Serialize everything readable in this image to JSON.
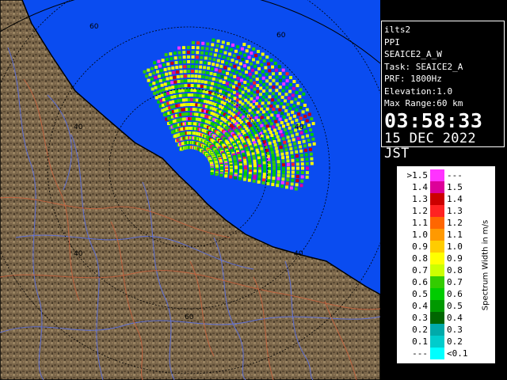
{
  "header": {
    "site": "ilts2",
    "product": "PPI",
    "scan_name": "SEAICE2_A_W",
    "task": "Task: SEAICE2_A",
    "prf": "PRF: 1800Hz",
    "elevation": "Elevation:1.0",
    "max_range": "Max Range:60 km",
    "time": "03:58:33",
    "date": "15 DEC 2022 JST"
  },
  "range_rings": {
    "labels": [
      "60",
      "60",
      "40",
      "40",
      "40",
      "40",
      "60"
    ]
  },
  "legend": {
    "title": "Spectrum Width in m/s",
    "rows": [
      {
        "lo": ">1.5",
        "hi": "---",
        "color": "#ff33ff"
      },
      {
        "lo": "1.4",
        "hi": "1.5",
        "color": "#dd0099"
      },
      {
        "lo": "1.3",
        "hi": "1.4",
        "color": "#cc0000"
      },
      {
        "lo": "1.2",
        "hi": "1.3",
        "color": "#ff2222"
      },
      {
        "lo": "1.1",
        "hi": "1.2",
        "color": "#ff6600"
      },
      {
        "lo": "1.0",
        "hi": "1.1",
        "color": "#ff9900"
      },
      {
        "lo": "0.9",
        "hi": "1.0",
        "color": "#ffcc00"
      },
      {
        "lo": "0.8",
        "hi": "0.9",
        "color": "#ffff00"
      },
      {
        "lo": "0.7",
        "hi": "0.8",
        "color": "#ccff00"
      },
      {
        "lo": "0.6",
        "hi": "0.7",
        "color": "#33cc00"
      },
      {
        "lo": "0.5",
        "hi": "0.6",
        "color": "#00cc00"
      },
      {
        "lo": "0.4",
        "hi": "0.5",
        "color": "#009900"
      },
      {
        "lo": "0.3",
        "hi": "0.4",
        "color": "#006600"
      },
      {
        "lo": "0.2",
        "hi": "0.3",
        "color": "#00aaaa"
      },
      {
        "lo": "0.1",
        "hi": "0.2",
        "color": "#00cccc"
      },
      {
        "lo": "---",
        "hi": "<0.1",
        "color": "#00ffff"
      }
    ]
  },
  "colors": {
    "sea": "#0a4cf0",
    "land": "#7a664a",
    "land_dark": "#4a3c2a",
    "coast": "#000000",
    "rivers": "#5d6fd6",
    "roads": "#c0623e"
  }
}
